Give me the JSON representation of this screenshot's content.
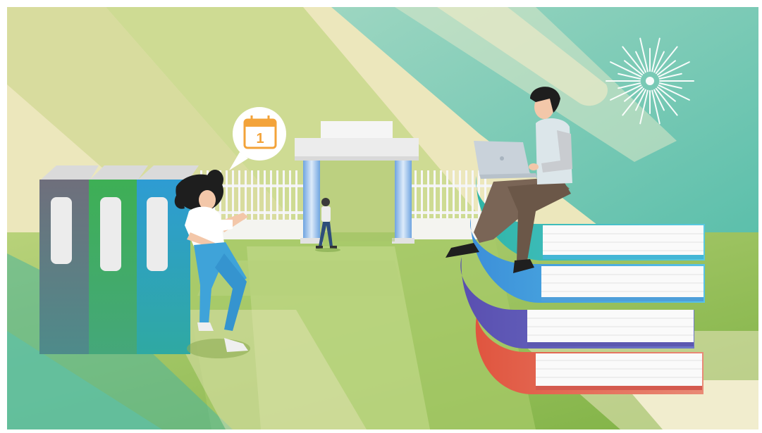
{
  "scene": {
    "calendar_day": "1",
    "elements": [
      "school-gate",
      "fence",
      "book-stack",
      "binder-books",
      "girl-running",
      "boy-with-laptop",
      "walking-student",
      "calendar-speech-bubble",
      "sparkle-burst"
    ]
  },
  "colors": {
    "cream": "#ECE7BC",
    "light_green": "#A9C96A",
    "mid_green": "#8DB84E",
    "teal": "#5CC3B0",
    "calendar_orange": "#F3A33A",
    "book_red": "#E06A4E",
    "book_purple": "#5E5BB3",
    "book_blue": "#4AB6DD"
  }
}
